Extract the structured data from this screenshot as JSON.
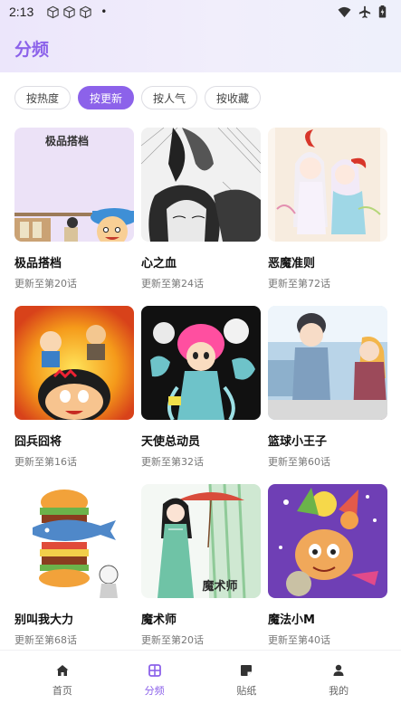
{
  "status": {
    "time": "2:13",
    "dot": "•"
  },
  "page": {
    "title": "分频"
  },
  "filters": [
    {
      "label": "按热度",
      "active": false
    },
    {
      "label": "按更新",
      "active": true
    },
    {
      "label": "按人气",
      "active": false
    },
    {
      "label": "按收藏",
      "active": false
    }
  ],
  "comics": [
    {
      "title": "极品搭档",
      "update": "更新至第20话",
      "cover_text": "极品搭档"
    },
    {
      "title": "心之血",
      "update": "更新至第24话"
    },
    {
      "title": "恶魔准则",
      "update": "更新至第72话"
    },
    {
      "title": "囧兵囧将",
      "update": "更新至第16话"
    },
    {
      "title": "天使总动员",
      "update": "更新至第32话"
    },
    {
      "title": "篮球小王子",
      "update": "更新至第60话"
    },
    {
      "title": "别叫我大力",
      "update": "更新至第68话"
    },
    {
      "title": "魔术师",
      "update": "更新至第20话",
      "cover_text": "魔术师"
    },
    {
      "title": "魔法小M",
      "update": "更新至第40话"
    }
  ],
  "tabs": [
    {
      "label": "首页",
      "icon": "home-icon"
    },
    {
      "label": "分频",
      "icon": "grid-icon",
      "active": true
    },
    {
      "label": "贴纸",
      "icon": "sticker-icon"
    },
    {
      "label": "我的",
      "icon": "person-icon"
    }
  ],
  "colors": {
    "accent": "#8c62ea"
  }
}
